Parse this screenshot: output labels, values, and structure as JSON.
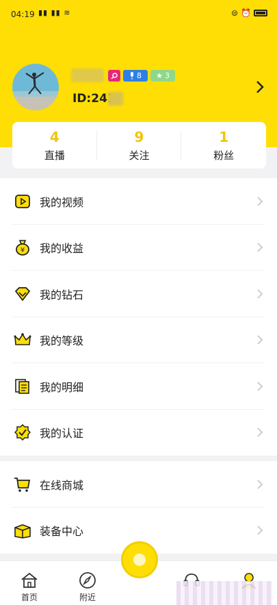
{
  "status_bar": {
    "time": "04:19",
    "signal": "HD all HD all"
  },
  "profile": {
    "user_id": "ID:241",
    "badges": {
      "key_label": "",
      "mic_level": "8",
      "star_level": "3"
    }
  },
  "stats": [
    {
      "value": "4",
      "label": "直播"
    },
    {
      "value": "9",
      "label": "关注"
    },
    {
      "value": "1",
      "label": "粉丝"
    }
  ],
  "menu_group_1": [
    {
      "label": "我的视频",
      "icon": "video-icon"
    },
    {
      "label": "我的收益",
      "icon": "money-bag-icon"
    },
    {
      "label": "我的钻石",
      "icon": "diamond-icon"
    },
    {
      "label": "我的等级",
      "icon": "crown-icon"
    },
    {
      "label": "我的明细",
      "icon": "ledger-icon"
    },
    {
      "label": "我的认证",
      "icon": "verified-icon"
    }
  ],
  "menu_group_2": [
    {
      "label": "在线商城",
      "icon": "cart-icon"
    },
    {
      "label": "装备中心",
      "icon": "gift-box-icon"
    }
  ],
  "tabbar": {
    "home": "首页",
    "nearby": "附近"
  },
  "colors": {
    "brand_yellow": "#ffde05",
    "stat_number": "#f1c40f"
  }
}
